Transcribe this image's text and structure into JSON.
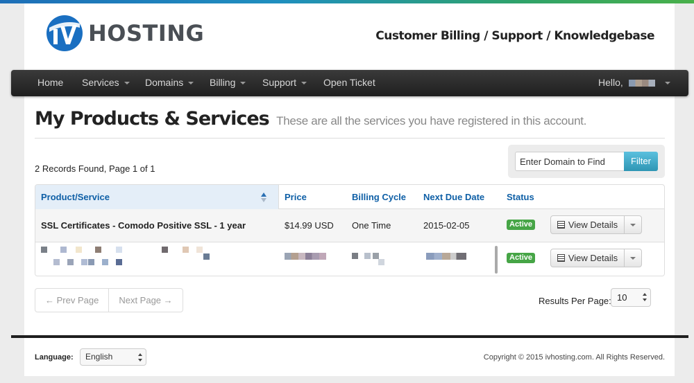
{
  "header": {
    "logo_text": "HOSTING",
    "tagline": "Customer Billing / Support / Knowledgebase",
    "colors": {
      "brand_blue": "#1a6fc1",
      "logo_gray": "#4a4f55"
    }
  },
  "nav": {
    "items": [
      {
        "label": "Home",
        "dropdown": false
      },
      {
        "label": "Services",
        "dropdown": true
      },
      {
        "label": "Domains",
        "dropdown": true
      },
      {
        "label": "Billing",
        "dropdown": true
      },
      {
        "label": "Support",
        "dropdown": true
      },
      {
        "label": "Open Ticket",
        "dropdown": false
      }
    ],
    "greeting": "Hello,"
  },
  "page": {
    "title": "My Products & Services",
    "subtitle": "These are all the services you have registered in this account."
  },
  "listing": {
    "records_text": "2 Records Found, Page 1 of 1",
    "filter_placeholder": "Enter Domain to Find",
    "filter_button": "Filter"
  },
  "table": {
    "columns": [
      "Product/Service",
      "Price",
      "Billing Cycle",
      "Next Due Date",
      "Status"
    ],
    "rows": [
      {
        "product": "SSL Certificates - Comodo Positive SSL - 1 year",
        "price": "$14.99 USD",
        "cycle": "One Time",
        "due": "2015-02-05",
        "status": "Active",
        "action": "View Details"
      },
      {
        "product": "",
        "price": "",
        "cycle": "",
        "due": "",
        "status": "Active",
        "action": "View Details"
      }
    ]
  },
  "pagination": {
    "prev": "← Prev Page",
    "next": "Next Page →",
    "rpp_label": "Results Per Page:",
    "rpp_value": "10"
  },
  "footer": {
    "language_label": "Language:",
    "language_value": "English",
    "copyright": "Copyright © 2015 ivhosting.com. All Rights Reserved."
  }
}
